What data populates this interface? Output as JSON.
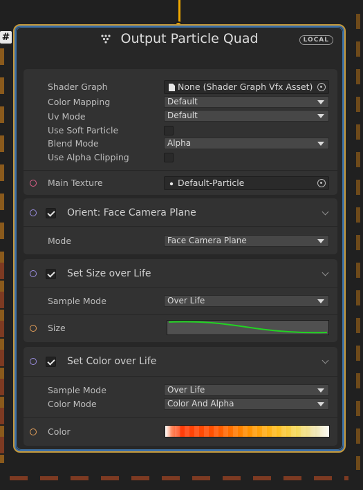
{
  "system": {
    "badge": "#"
  },
  "node": {
    "title": "Output Particle Quad",
    "badge": "LOCAL",
    "icon": "particle-output-icon",
    "accent_color": "#c69a3c",
    "selection_color": "#3d6f9e"
  },
  "settings": {
    "shader_graph": {
      "label": "Shader Graph",
      "value": "None (Shader Graph Vfx Asset)",
      "icon": "file-icon"
    },
    "color_mapping": {
      "label": "Color Mapping",
      "value": "Default"
    },
    "uv_mode": {
      "label": "Uv Mode",
      "value": "Default"
    },
    "use_soft_particle": {
      "label": "Use Soft Particle"
    },
    "blend_mode": {
      "label": "Blend Mode",
      "value": "Alpha"
    },
    "use_alpha_clipping": {
      "label": "Use Alpha Clipping"
    },
    "main_texture": {
      "label": "Main Texture",
      "value": "Default-Particle",
      "icon": "texture-icon"
    }
  },
  "blocks": {
    "orient": {
      "title": "Orient: Face Camera Plane",
      "mode_label": "Mode",
      "mode_value": "Face Camera Plane"
    },
    "size": {
      "title": "Set Size over Life",
      "sample_label": "Sample Mode",
      "sample_value": "Over Life",
      "size_label": "Size",
      "curve_color": "#22d322"
    },
    "color": {
      "title": "Set Color over Life",
      "sample_label": "Sample Mode",
      "sample_value": "Over Life",
      "mode_label": "Color Mode",
      "mode_value": "Color And Alpha",
      "color_label": "Color"
    }
  },
  "colors": {
    "flow": "#f0a800",
    "port_pink": "#e0608c",
    "port_orange": "#e5a05a",
    "port_purple": "#9b8ee0"
  }
}
